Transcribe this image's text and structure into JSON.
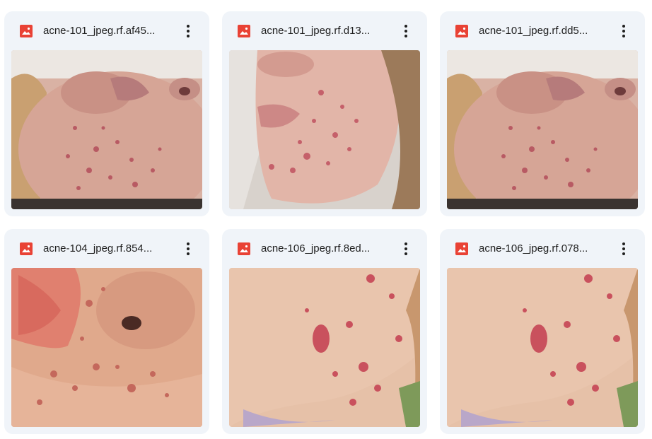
{
  "files": [
    {
      "name": "acne-101_jpeg.rf.af45...",
      "icon": "image-file-icon",
      "thumbnail": "face-cheek-acne"
    },
    {
      "name": "acne-101_jpeg.rf.d13...",
      "icon": "image-file-icon",
      "thumbnail": "face-chin-acne"
    },
    {
      "name": "acne-101_jpeg.rf.dd5...",
      "icon": "image-file-icon",
      "thumbnail": "face-cheek-acne"
    },
    {
      "name": "acne-104_jpeg.rf.854...",
      "icon": "image-file-icon",
      "thumbnail": "lips-nose-acne"
    },
    {
      "name": "acne-106_jpeg.rf.8ed...",
      "icon": "image-file-icon",
      "thumbnail": "jaw-acne"
    },
    {
      "name": "acne-106_jpeg.rf.078...",
      "icon": "image-file-icon",
      "thumbnail": "jaw-acne"
    }
  ],
  "colors": {
    "card_bg": "#f0f4f9",
    "icon_red": "#e94235",
    "text": "#1f1f1f"
  }
}
